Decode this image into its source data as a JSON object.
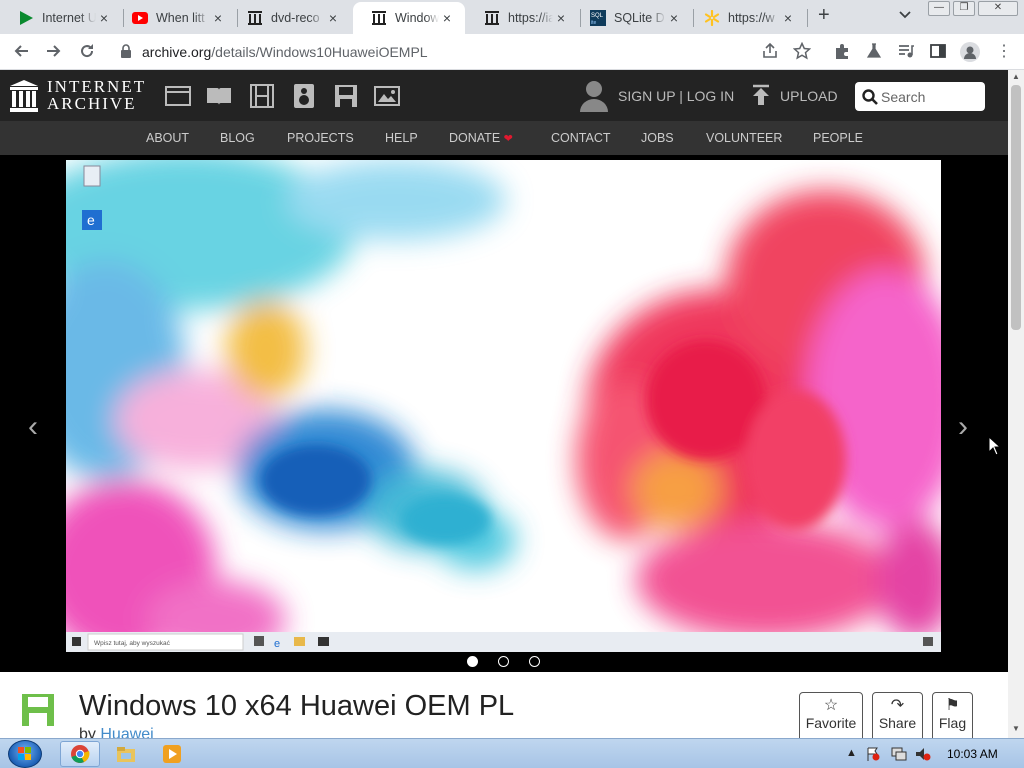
{
  "browser": {
    "tabs": [
      {
        "title": "Internet U",
        "icon": "play-icon",
        "active": false
      },
      {
        "title": "When litt",
        "icon": "youtube-icon",
        "active": false
      },
      {
        "title": "dvd-reco",
        "icon": "archive-icon",
        "active": false
      },
      {
        "title": "Windows",
        "icon": "archive-icon",
        "active": true
      },
      {
        "title": "https://ia",
        "icon": "archive-icon",
        "active": false
      },
      {
        "title": "SQLite D",
        "icon": "sqlite-icon",
        "active": false
      },
      {
        "title": "https://w",
        "icon": "walmart-icon",
        "active": false
      }
    ],
    "new_tab": "+",
    "close": "×",
    "url_host": "archive.org",
    "url_path": "/details/Windows10HuaweiOEMPL"
  },
  "site": {
    "logo_line1": "INTERNET",
    "logo_line2": "ARCHIVE",
    "media_icons": [
      "web-icon",
      "texts-icon",
      "video-icon",
      "audio-icon",
      "software-icon",
      "images-icon"
    ],
    "signup": "SIGN UP | LOG IN",
    "upload": "UPLOAD",
    "search_placeholder": "Search",
    "nav": [
      "ABOUT",
      "BLOG",
      "PROJECTS",
      "HELP",
      "DONATE",
      "CONTACT",
      "JOBS",
      "VOLUNTEER",
      "PEOPLE"
    ],
    "donate_heart": "❤",
    "carousel": {
      "slides": 3,
      "current": 1,
      "prev": "‹",
      "next": "›"
    },
    "desktop_preview": {
      "search_text": "Wpisz tutaj, aby wyszukać",
      "icon_labels": [
        "Kosz",
        "Microsoft Edge"
      ]
    },
    "item": {
      "title": "Windows 10 x64 Huawei OEM PL",
      "by_prefix": "by",
      "creator": "Huawei",
      "actions": [
        "Favorite",
        "Share",
        "Flag"
      ]
    }
  },
  "taskbar": {
    "time": "10:03 AM",
    "apps": [
      "chrome-icon",
      "explorer-icon",
      "media-player-icon"
    ]
  },
  "colors": {
    "donate_heart": "#e0192f",
    "ia_dark": "#232323",
    "ia_nav": "#333333",
    "link": "#428bca",
    "taskbar": "#b3cbe9"
  }
}
